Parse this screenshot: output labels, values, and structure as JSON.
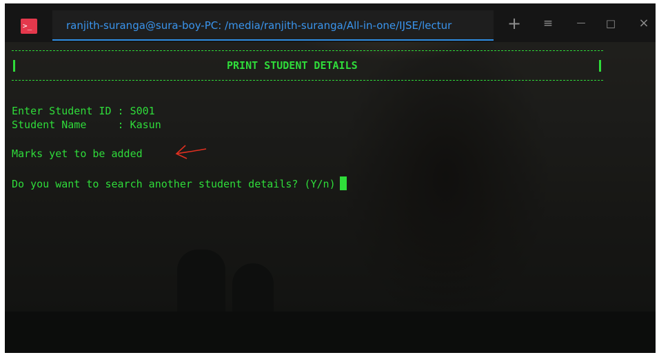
{
  "window": {
    "app_icon_glyph": ">_",
    "tab_title": "ranjith-suranga@sura-boy-PC: /media/ranjith-suranga/All-in-one/IJSE/lectur",
    "accent_color": "#2f8ee4",
    "text_color": "#2fdc3a",
    "icon_color": "#e4384c",
    "controls": {
      "new_tab": "+",
      "menu": "≡",
      "minimize": "—",
      "maximize": "□",
      "close": "×"
    }
  },
  "terminal": {
    "header_title": "PRINT STUDENT DETAILS",
    "border_char": "|",
    "student_id_line": "Enter Student ID : S001",
    "student_name_line": "Student Name     : Kasun",
    "marks_message": "Marks yet to be added",
    "prompt": "Do you want to search another student details? (Y/n)"
  }
}
